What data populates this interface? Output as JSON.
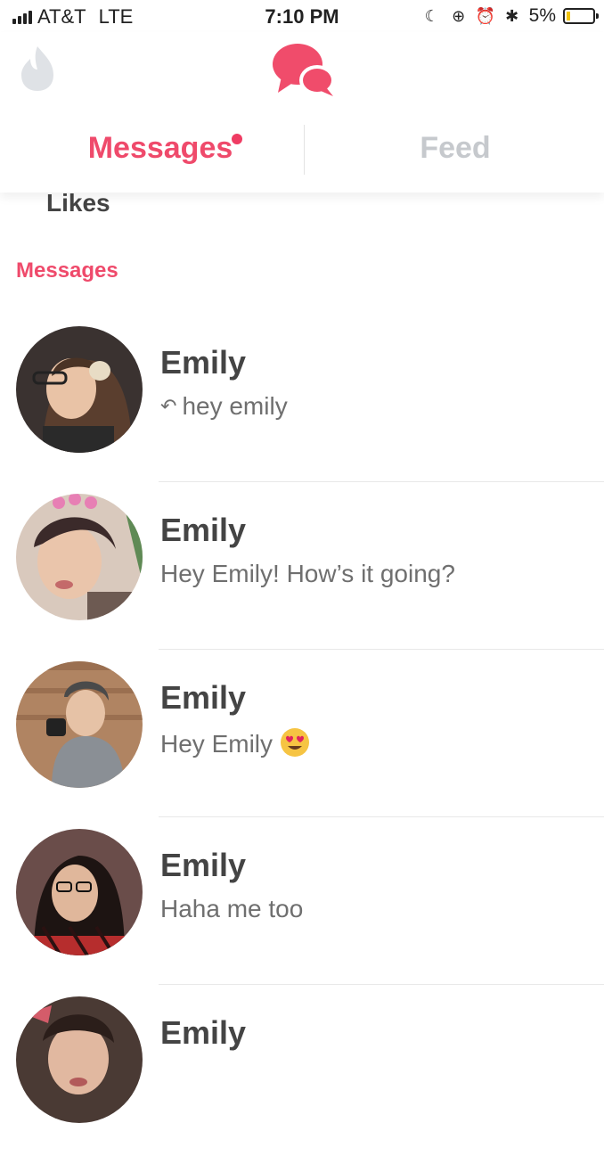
{
  "status_bar": {
    "carrier": "AT&T",
    "network": "LTE",
    "time": "7:10 PM",
    "battery_percent": "5%",
    "icons": [
      "moon-icon",
      "rotation-lock-icon",
      "alarm-icon",
      "bluetooth-icon",
      "battery-icon"
    ]
  },
  "top_nav": {
    "left_icon": "flame-icon",
    "center_icon": "chat-bubbles-icon",
    "tabs": [
      {
        "label": "Messages",
        "active": true,
        "has_notification_dot": true
      },
      {
        "label": "Feed",
        "active": false
      }
    ]
  },
  "likes_label": "Likes",
  "messages_heading": "Messages",
  "messages": [
    {
      "name": "Emily",
      "preview": "hey emily",
      "replied": true
    },
    {
      "name": "Emily",
      "preview": "Hey Emily! How’s it going?"
    },
    {
      "name": "Emily",
      "preview": "Hey Emily",
      "emoji": "heart-eyes-emoji-icon"
    },
    {
      "name": "Emily",
      "preview": "Haha me too"
    },
    {
      "name": "Emily",
      "preview": ""
    }
  ],
  "colors": {
    "accent": "#ef4a6b",
    "inactive_tab": "#c6c9cd",
    "text": "#444444",
    "preview_text": "#6f6f6f"
  }
}
